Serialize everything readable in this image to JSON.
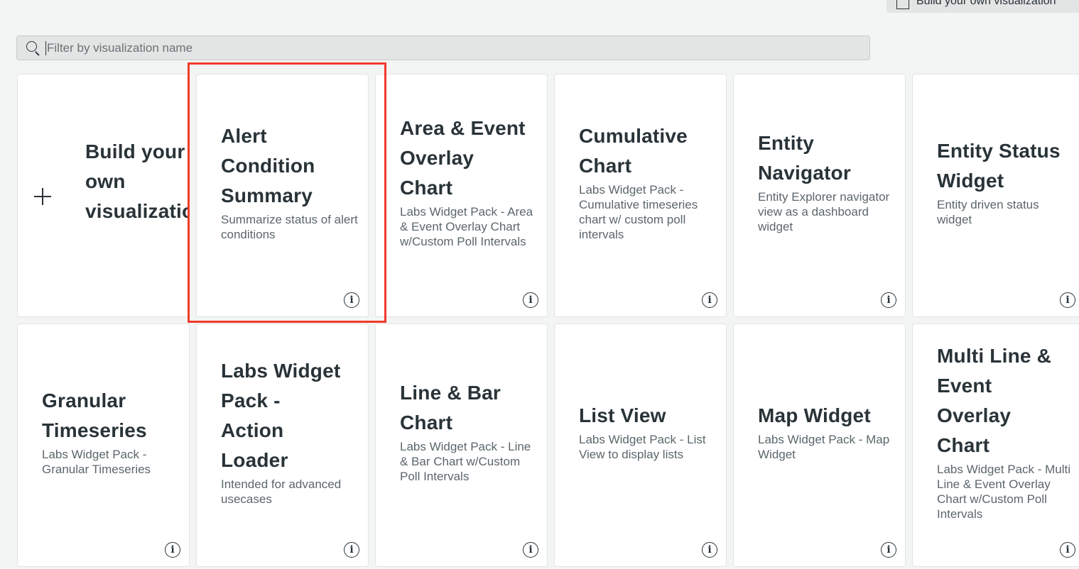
{
  "top_button": {
    "label": "Build your own visualization",
    "icon": "chart-icon"
  },
  "filter": {
    "placeholder": "Filter by visualization name",
    "value": ""
  },
  "build_card": {
    "title_lines": [
      "Build your",
      "own",
      "visualization"
    ],
    "icon": "plus-icon"
  },
  "cards": [
    {
      "id": "alert-condition-summary",
      "title_lines": [
        "Alert",
        "Condition",
        "Summary"
      ],
      "desc": "Summarize status of alert conditions"
    },
    {
      "id": "area-event-overlay-chart",
      "title_lines": [
        "Area & Event",
        "Overlay",
        "Chart"
      ],
      "desc": "Labs Widget Pack - Area & Event Overlay Chart w/Custom Poll Intervals"
    },
    {
      "id": "cumulative-chart",
      "title_lines": [
        "Cumulative",
        "Chart"
      ],
      "desc": "Labs Widget Pack - Cumulative timeseries chart w/ custom poll intervals"
    },
    {
      "id": "entity-navigator",
      "title_lines": [
        "Entity",
        "Navigator"
      ],
      "desc": "Entity Explorer navigator view as a dashboard widget"
    },
    {
      "id": "entity-status-widget",
      "title_lines": [
        "Entity Status",
        "Widget"
      ],
      "desc": "Entity driven status widget"
    },
    {
      "id": "granular-timeseries",
      "title_lines": [
        "Granular",
        "Timeseries"
      ],
      "desc": "Labs Widget Pack - Granular Timeseries"
    },
    {
      "id": "action-loader",
      "title_lines": [
        "Labs Widget",
        "Pack -",
        "Action",
        "Loader"
      ],
      "desc": "Intended for advanced usecases"
    },
    {
      "id": "line-bar-chart",
      "title_lines": [
        "Line & Bar",
        "Chart"
      ],
      "desc": "Labs Widget Pack - Line & Bar Chart w/Custom Poll Intervals"
    },
    {
      "id": "list-view",
      "title_lines": [
        "List View"
      ],
      "desc": "Labs Widget Pack - List View to display lists"
    },
    {
      "id": "map-widget",
      "title_lines": [
        "Map Widget"
      ],
      "desc": "Labs Widget Pack - Map Widget"
    },
    {
      "id": "multi-line-event-overlay-chart",
      "title_lines": [
        "Multi Line &",
        "Event",
        "Overlay",
        "Chart"
      ],
      "desc": "Labs Widget Pack - Multi Line & Event Overlay Chart w/Custom Poll Intervals"
    }
  ],
  "info_glyph": "i",
  "highlight_color": "#f23a2a"
}
